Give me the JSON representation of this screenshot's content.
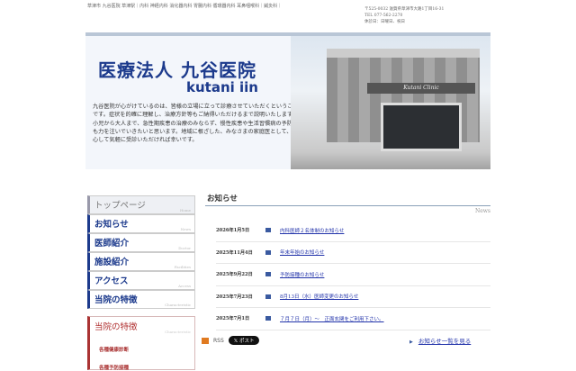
{
  "header": {
    "links": "草津市 九谷医院 草津駅｜内科 神経内科 消化器内科 胃腸内科 循環器内科 耳鼻咽喉科｜鍼灸科｜",
    "address": "〒525-0032 滋賀県草津市大路1丁目16-31",
    "tel": "TEL 077-562-2270",
    "closed": "休診日：日曜日、祝日"
  },
  "banner": {
    "title_jp": "医療法人 九谷医院",
    "title_en": "kutani iin",
    "sign": "Kutani Clinic",
    "intro": "九谷医院が心がけているのは、皆様の立場に立って診療させていただくということです。症状を的確に理解し、治療方針等もご納得いただけるまで説明いたします。小児から大人まで、急性期疾患の治療のみならず、慢性疾患や生活習慣病の予防にも力を注いでいきたいと思います。地域に根ざした、みなさまの家庭医として、安心して気軽に受診いただければ幸いです。"
  },
  "sidebar": {
    "items": [
      {
        "jp": "トップページ",
        "en": "Home"
      },
      {
        "jp": "お知らせ",
        "en": "News"
      },
      {
        "jp": "医師紹介",
        "en": "Doctor"
      },
      {
        "jp": "施設紹介",
        "en": "Facilities"
      },
      {
        "jp": "アクセス",
        "en": "Access"
      },
      {
        "jp": "当院の特徴",
        "en": "Characteristic"
      }
    ],
    "feature": {
      "jp": "当院の特徴",
      "en": "Characteristic",
      "subs": [
        "各種健康診断",
        "各種予防接種"
      ]
    }
  },
  "news": {
    "title": "お知らせ",
    "en": "News",
    "items": [
      {
        "date": "2026年1月5日",
        "title": "内科医師２名体制のお知らせ"
      },
      {
        "date": "2025年11月4日",
        "title": "年末年始のお知らせ"
      },
      {
        "date": "2025年9月22日",
        "title": "予防接種のお知らせ"
      },
      {
        "date": "2025年7月23日",
        "title": "8月13日（水）医師変更のお知らせ"
      },
      {
        "date": "2025年7月1日",
        "title": "７月７日（月）～　正面玄関をご利用下さい。"
      }
    ],
    "rss": "RSS",
    "post": "𝕏 ポスト",
    "more": "お知らせ一覧を見る"
  }
}
